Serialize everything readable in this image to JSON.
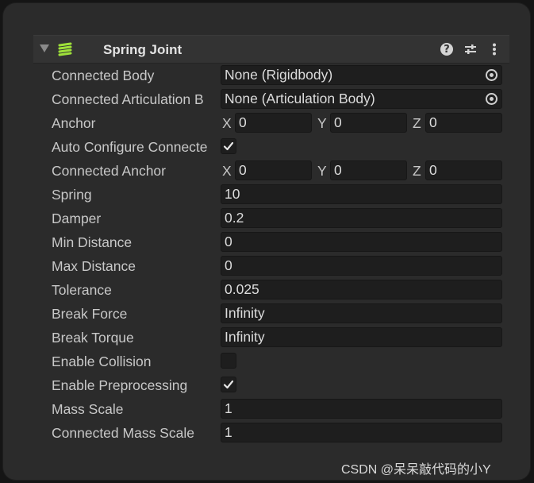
{
  "component": {
    "title": "Spring Joint",
    "icon": "spring-joint-icon",
    "accent_color": "#9ee03a"
  },
  "header_buttons": {
    "help": "?",
    "presets_icon": "sliders-icon",
    "more_icon": "kebab-menu-icon"
  },
  "fields": {
    "connected_body": {
      "label": "Connected Body",
      "value": "None (Rigidbody)"
    },
    "connected_articulation_body": {
      "label": "Connected Articulation B",
      "value": "None (Articulation Body)"
    },
    "anchor": {
      "label": "Anchor",
      "x_label": "X",
      "x": "0",
      "y_label": "Y",
      "y": "0",
      "z_label": "Z",
      "z": "0"
    },
    "auto_configure": {
      "label": "Auto Configure Connecte",
      "checked": true
    },
    "connected_anchor": {
      "label": "Connected Anchor",
      "x_label": "X",
      "x": "0",
      "y_label": "Y",
      "y": "0",
      "z_label": "Z",
      "z": "0"
    },
    "spring": {
      "label": "Spring",
      "value": "10"
    },
    "damper": {
      "label": "Damper",
      "value": "0.2"
    },
    "min_distance": {
      "label": "Min Distance",
      "value": "0"
    },
    "max_distance": {
      "label": "Max Distance",
      "value": "0"
    },
    "tolerance": {
      "label": "Tolerance",
      "value": "0.025"
    },
    "break_force": {
      "label": "Break Force",
      "value": "Infinity"
    },
    "break_torque": {
      "label": "Break Torque",
      "value": "Infinity"
    },
    "enable_collision": {
      "label": "Enable Collision",
      "checked": false
    },
    "enable_preprocessing": {
      "label": "Enable Preprocessing",
      "checked": true
    },
    "mass_scale": {
      "label": "Mass Scale",
      "value": "1"
    },
    "connected_mass_scale": {
      "label": "Connected Mass Scale",
      "value": "1"
    }
  },
  "watermark": "CSDN @呆呆敲代码的小Y"
}
